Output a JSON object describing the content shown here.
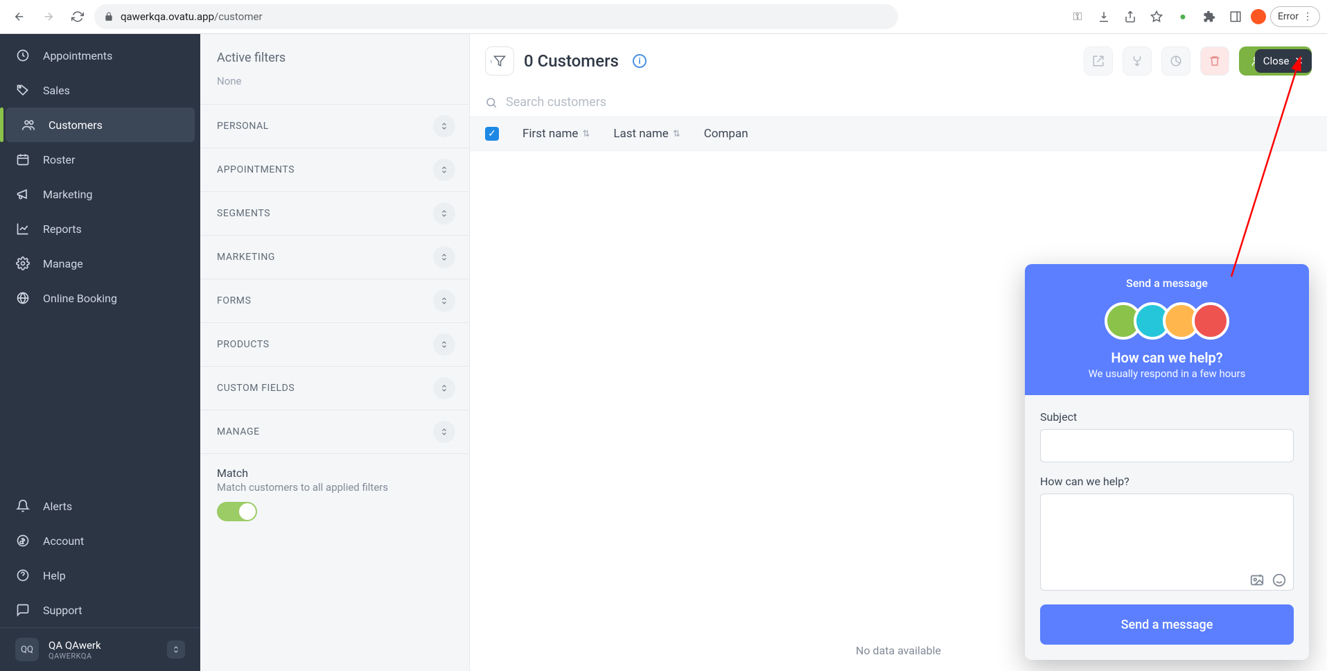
{
  "browser": {
    "url_host": "qawerkqa.ovatu.app",
    "url_path": "/customer",
    "error_label": "Error"
  },
  "sidebar": {
    "items": [
      {
        "label": "Appointments",
        "icon": "clock-icon"
      },
      {
        "label": "Sales",
        "icon": "tag-icon"
      },
      {
        "label": "Customers",
        "icon": "users-icon",
        "active": true
      },
      {
        "label": "Roster",
        "icon": "calendar-icon"
      },
      {
        "label": "Marketing",
        "icon": "megaphone-icon"
      },
      {
        "label": "Reports",
        "icon": "chart-icon"
      },
      {
        "label": "Manage",
        "icon": "gear-icon"
      },
      {
        "label": "Online Booking",
        "icon": "globe-icon"
      }
    ],
    "lower": [
      {
        "label": "Alerts",
        "icon": "bell-icon"
      },
      {
        "label": "Account",
        "icon": "coin-icon"
      },
      {
        "label": "Help",
        "icon": "help-icon"
      },
      {
        "label": "Support",
        "icon": "chat-icon"
      }
    ],
    "user": {
      "initials": "QQ",
      "name": "QA QAwerk",
      "sub": "QAWERKQA"
    }
  },
  "filters": {
    "title": "Active filters",
    "none": "None",
    "sections": [
      "PERSONAL",
      "APPOINTMENTS",
      "SEGMENTS",
      "MARKETING",
      "FORMS",
      "PRODUCTS",
      "CUSTOM FIELDS",
      "MANAGE"
    ],
    "match": {
      "title": "Match",
      "desc": "Match customers to all applied filters"
    }
  },
  "main": {
    "title": "0 Customers",
    "search_placeholder": "Search customers",
    "new_btn": "New c",
    "close_label": "Close",
    "columns": [
      "First name",
      "Last name",
      "Compan"
    ],
    "nodata": "No data available"
  },
  "chat": {
    "header_title": "Send a message",
    "how": "How can we help?",
    "respond": "We usually respond in a few hours",
    "subject_label": "Subject",
    "body_label": "How can we help?",
    "send_btn": "Send a message",
    "avatar_colors": [
      "#8bc34a",
      "#26c6da",
      "#ffb74d",
      "#ef5350"
    ]
  }
}
